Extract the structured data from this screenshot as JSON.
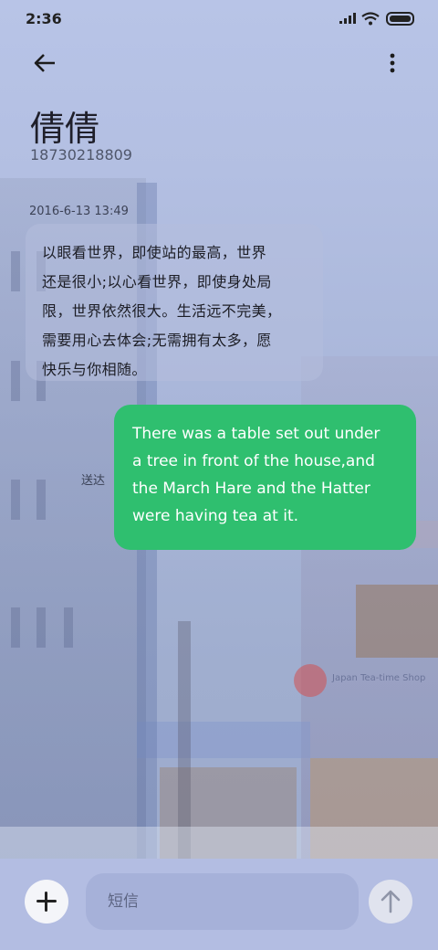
{
  "status_bar": {
    "time": "2:36",
    "icons": [
      "signal-icon",
      "wifi-icon",
      "battery-icon"
    ]
  },
  "header": {
    "back_icon": "arrow-left-icon",
    "more_icon": "more-vertical-icon",
    "contact_name": "倩倩",
    "phone_number": "18730218809"
  },
  "conversation": {
    "timestamp": "2016-6-13 13:49",
    "incoming": {
      "lines": [
        "以眼看世界，即使站的最高，世界",
        "还是很小;以心看世界，即使身处局",
        "限，世界依然很大。生活远不完美，",
        "需要用心去体会;无需拥有太多，愿",
        "快乐与你相随。"
      ]
    },
    "outgoing": {
      "lines": [
        "There was a table set out under",
        "a tree in front of the house,and",
        "the March Hare and the Hatter",
        "were having tea at it."
      ],
      "status": "送达",
      "color": "#2fbf6f"
    }
  },
  "background": {
    "shop_sign": "Japan Tea-time Shop"
  },
  "composer": {
    "add_icon": "plus-icon",
    "placeholder": "短信",
    "send_icon": "arrow-up-icon"
  }
}
